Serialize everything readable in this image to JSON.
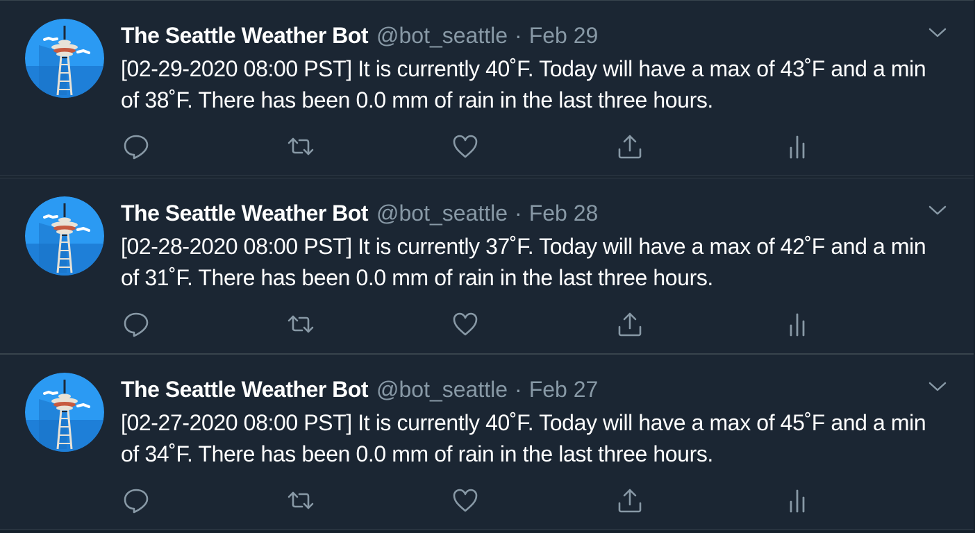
{
  "account": {
    "display_name": "The Seattle Weather Bot",
    "handle": "@bot_seattle",
    "avatar_icon": "space-needle-icon",
    "avatar_bg": "#2b9af3"
  },
  "separator": "·",
  "icons": {
    "caret": "chevron-down-icon",
    "reply": "reply-icon",
    "retweet": "retweet-icon",
    "like": "heart-icon",
    "share": "share-icon",
    "analytics": "analytics-icon"
  },
  "colors": {
    "background": "#15202b",
    "card": "#1b2633",
    "text": "#ffffff",
    "muted": "#8899a6",
    "border": "#38444d"
  },
  "tweets": [
    {
      "date": "Feb 29",
      "text": "[02-29-2020 08:00 PST] It is currently 40˚F. Today will have a max of 43˚F and a min of 38˚F. There has been 0.0 mm of rain in the last three hours."
    },
    {
      "date": "Feb 28",
      "text": "[02-28-2020 08:00 PST] It is currently 37˚F. Today will have a max of 42˚F and a min of 31˚F. There has been 0.0 mm of rain in the last three hours."
    },
    {
      "date": "Feb 27",
      "text": "[02-27-2020 08:00 PST] It is currently 40˚F. Today will have a max of 45˚F and a min of 34˚F. There has been 0.0 mm of rain in the last three hours."
    }
  ]
}
